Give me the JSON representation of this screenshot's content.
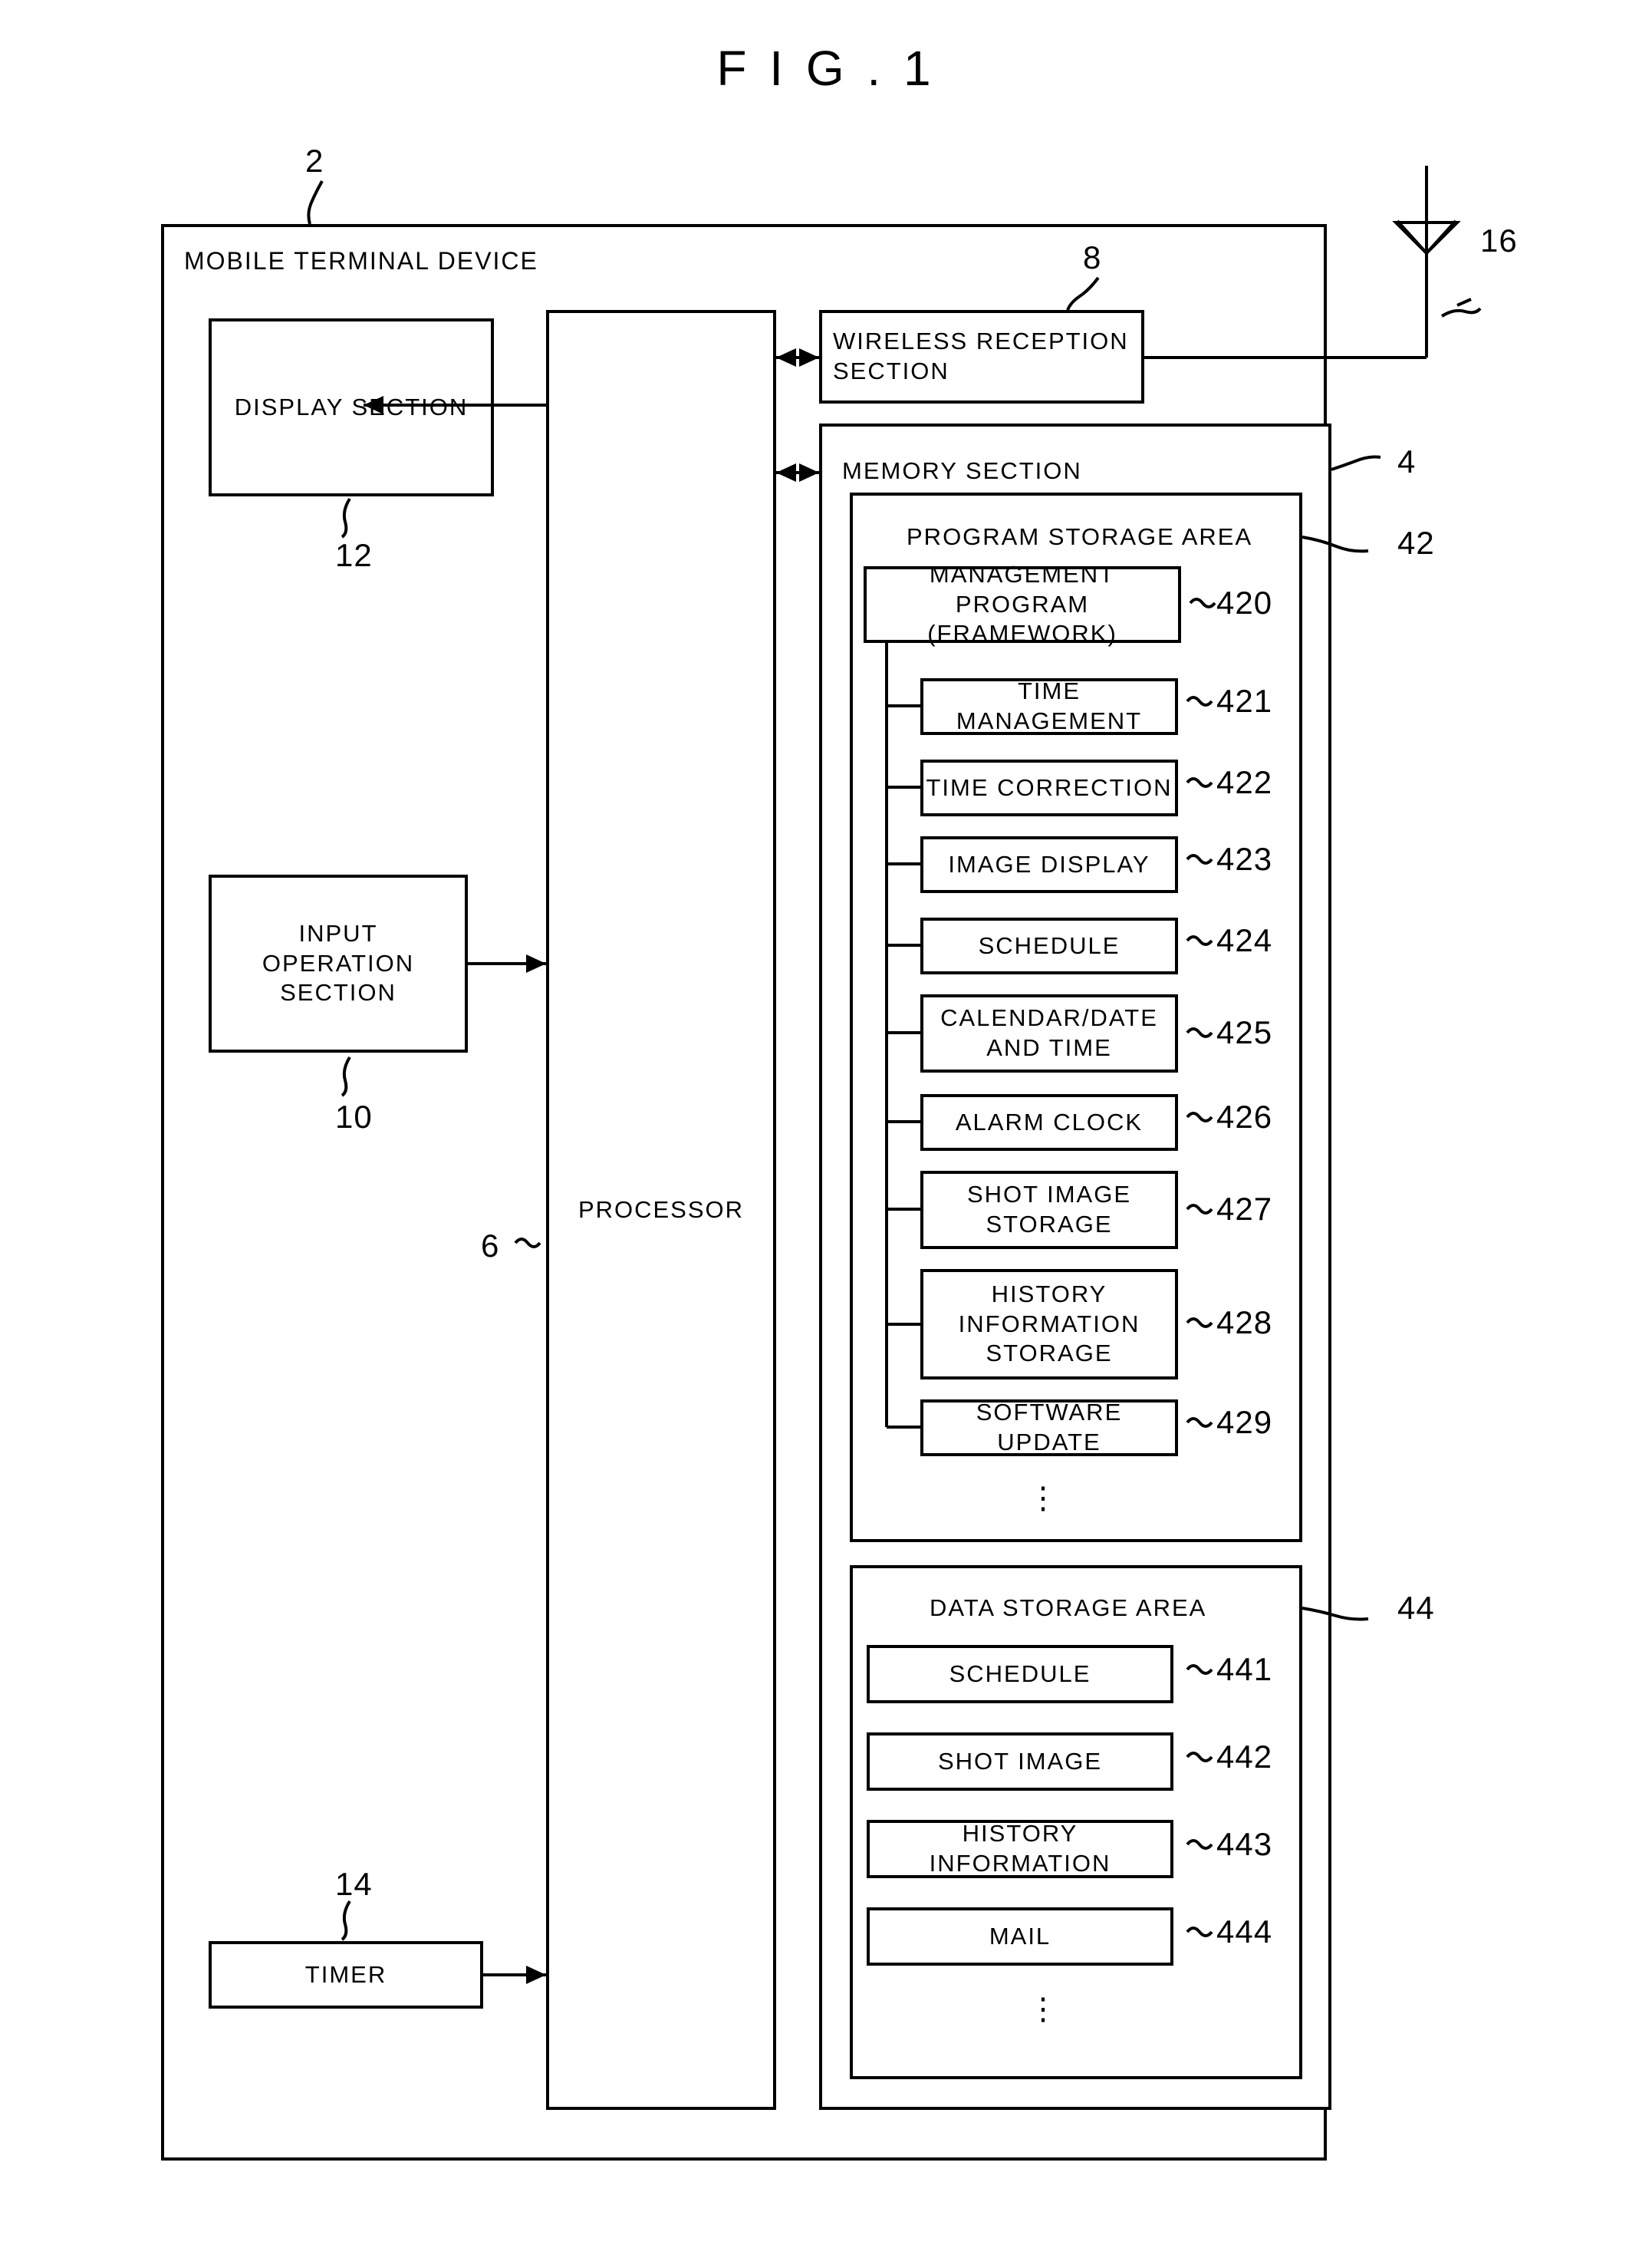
{
  "figure": {
    "title": "F I G . 1"
  },
  "outer": {
    "label": "MOBILE TERMINAL DEVICE",
    "ref": "2"
  },
  "blocks": {
    "display_section": {
      "label": "DISPLAY SECTION",
      "ref": "12"
    },
    "input_operation_section": {
      "label": "INPUT\nOPERATION\nSECTION",
      "line1": "INPUT",
      "line2": "OPERATION",
      "line3": "SECTION",
      "ref": "10"
    },
    "processor": {
      "label": "PROCESSOR",
      "ref": "6"
    },
    "timer": {
      "label": "TIMER",
      "ref": "14"
    },
    "wireless_reception": {
      "line1": "WIRELESS RECEPTION",
      "line2": "SECTION",
      "ref": "8"
    },
    "antenna": {
      "ref": "16"
    },
    "memory_section": {
      "label": "MEMORY SECTION",
      "ref": "4"
    },
    "program_storage_area": {
      "label": "PROGRAM STORAGE AREA",
      "ref": "42"
    },
    "data_storage_area": {
      "label": "DATA STORAGE AREA",
      "ref": "44"
    }
  },
  "program_items": [
    {
      "label": "MANAGEMENT PROGRAM\n(FRAMEWORK)",
      "line1": "MANAGEMENT PROGRAM",
      "line2": "(FRAMEWORK)",
      "ref": "420"
    },
    {
      "label": "TIME MANAGEMENT",
      "ref": "421"
    },
    {
      "label": "TIME CORRECTION",
      "ref": "422"
    },
    {
      "label": "IMAGE DISPLAY",
      "ref": "423"
    },
    {
      "label": "SCHEDULE",
      "ref": "424"
    },
    {
      "label": "CALENDAR/DATE\nAND TIME",
      "line1": "CALENDAR/DATE",
      "line2": "AND TIME",
      "ref": "425"
    },
    {
      "label": "ALARM CLOCK",
      "ref": "426"
    },
    {
      "label": "SHOT IMAGE\nSTORAGE",
      "line1": "SHOT IMAGE",
      "line2": "STORAGE",
      "ref": "427"
    },
    {
      "label": "HISTORY\nINFORMATION\nSTORAGE",
      "line1": "HISTORY",
      "line2": "INFORMATION",
      "line3": "STORAGE",
      "ref": "428"
    },
    {
      "label": "SOFTWARE UPDATE",
      "ref": "429"
    }
  ],
  "data_items": [
    {
      "label": "SCHEDULE",
      "ref": "441"
    },
    {
      "label": "SHOT IMAGE",
      "ref": "442"
    },
    {
      "label": "HISTORY INFORMATION",
      "ref": "443"
    },
    {
      "label": "MAIL",
      "ref": "444"
    }
  ],
  "ellipsis": "⋮"
}
